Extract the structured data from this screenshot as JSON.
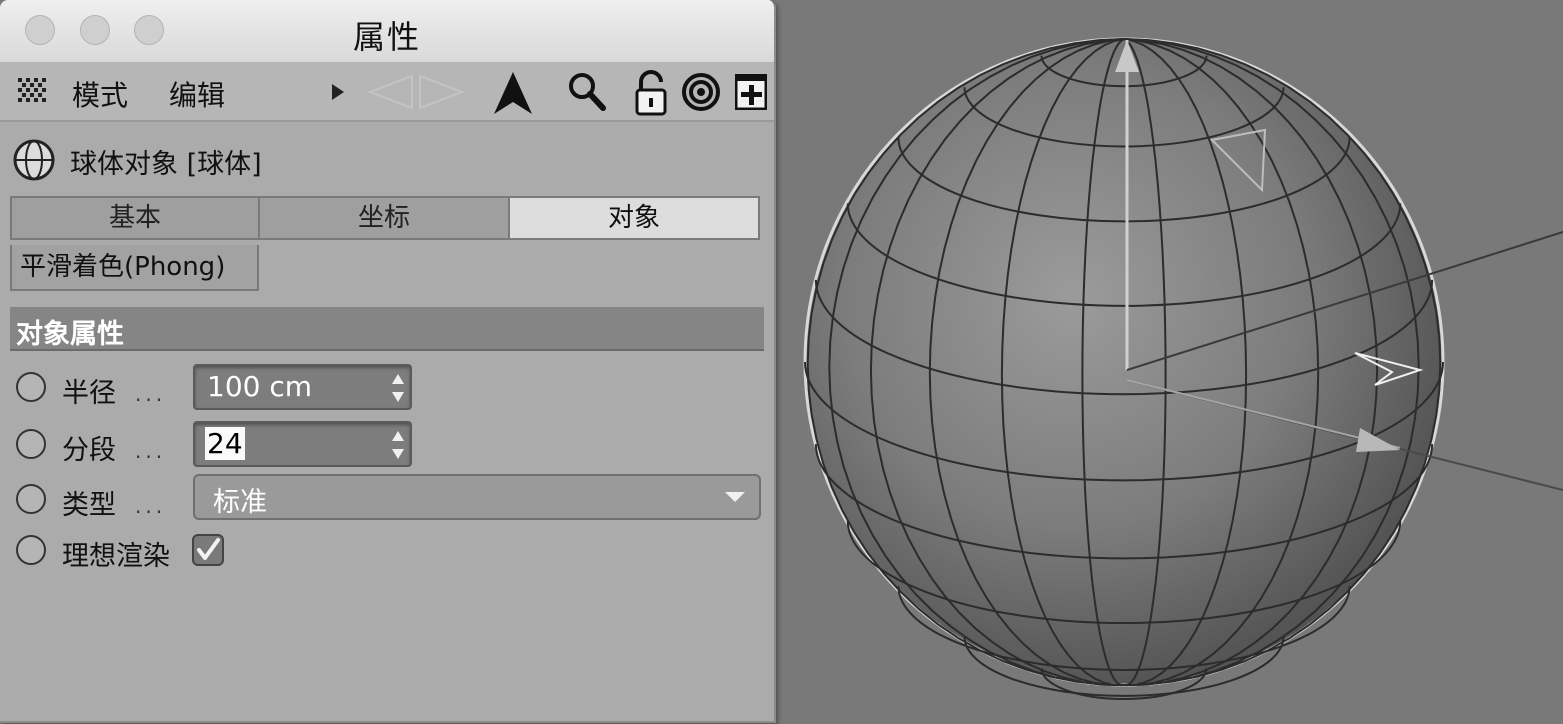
{
  "window": {
    "title": "属性"
  },
  "menubar": {
    "mode": "模式",
    "edit": "编辑"
  },
  "object": {
    "title": "球体对象 [球体]"
  },
  "tabs": [
    {
      "label": "基本",
      "active": false
    },
    {
      "label": "坐标",
      "active": false
    },
    {
      "label": "对象",
      "active": true
    }
  ],
  "subtab": {
    "label": "平滑着色(Phong)"
  },
  "section": {
    "title": "对象属性"
  },
  "params": {
    "radius": {
      "label": "半径",
      "dots": "...",
      "value": "100 cm"
    },
    "segments": {
      "label": "分段",
      "dots": "...",
      "value": "24"
    },
    "type": {
      "label": "类型",
      "dots": "...",
      "value": "标准"
    },
    "render_perfect": {
      "label": "理想渲染",
      "checked": true
    }
  },
  "colors": {
    "viewport_bg": "#797979",
    "panel_bg": "#ababab",
    "section_bar": "#858585"
  }
}
